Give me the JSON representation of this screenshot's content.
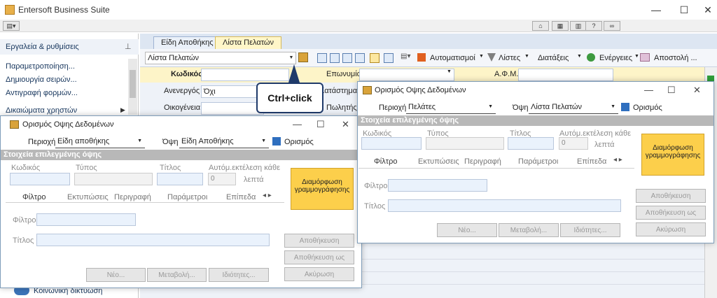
{
  "app": {
    "title": "Entersoft Business Suite",
    "window_controls": {
      "minimize": "—",
      "maximize": "☐",
      "close": "✕"
    }
  },
  "left_panel": {
    "header": "Εργαλεία & ρυθμίσεις",
    "items": [
      "Παραμετροποίηση...",
      "Δημιουργία σειρών...",
      "Αντιγραφή φορμών..."
    ],
    "section": "Δικαιώματα χρηστών",
    "bottom_item": "Κοινωνική δικτύωση"
  },
  "tabs": [
    {
      "label": "Είδη Αποθήκης"
    },
    {
      "label": "Λίστα Πελατών"
    }
  ],
  "toolbar": {
    "view_select": "Λίστα Πελατών",
    "automations": "Αυτοματισμοί",
    "lists": "Λίστες",
    "layouts": "Διατάξεις",
    "actions": "Ενέργειες",
    "send": "Αποστολή ..."
  },
  "form": {
    "code_label": "Κωδικός",
    "name_label": "Επωνυμία",
    "afm_label": "Α.Φ.Μ.",
    "inactive_label": "Ανενεργός",
    "inactive_value": "Όχι",
    "family_label": "Οικογένεια",
    "store_label": "Κατάστημα",
    "city_label": "Πωλητής"
  },
  "callout": "Ctrl+click",
  "dialog_common": {
    "title": "Ορισμός Οψης Δεδομένων",
    "area_label": "Περιοχή",
    "view_label": "Όψη",
    "define_label": "Ορισμός",
    "section_title": "Στοιχεία επιλεγμένης όψης",
    "code_label": "Κωδικός",
    "type_label": "Τύπος",
    "title_label": "Τίτλος",
    "auto_label": "Αυτόμ.εκτέλεση κάθε",
    "auto_value": "0",
    "minutes_label": "λεπτά",
    "tabs": [
      "Φίλτρο",
      "Εκτυπώσεις",
      "Περιγραφή",
      "Παράμετροι",
      "Επίπεδα"
    ],
    "filter_label": "Φίλτρο",
    "title_field_label": "Τίτλος",
    "format_button": "Διαμόρφωση γραμμογράφησης",
    "save": "Αποθήκευση",
    "save_as": "Αποθήκευση ως",
    "cancel": "Ακύρωση",
    "new": "Νέο...",
    "change": "Μεταβολή...",
    "properties": "Ιδιότητες..."
  },
  "dialog_left": {
    "area_value": "Είδη αποθήκης",
    "view_value": "Είδη Αποθήκης"
  },
  "dialog_right": {
    "area_value": "Πελάτες",
    "view_value": "Λίστα Πελατών"
  }
}
